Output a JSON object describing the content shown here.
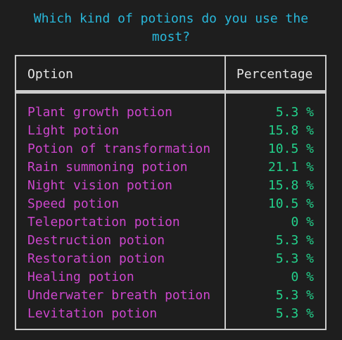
{
  "question": "Which kind of potions do you use the\nmost?",
  "table": {
    "headers": {
      "option": "Option",
      "percentage": "Percentage"
    },
    "rows": [
      {
        "option": "Plant growth potion",
        "percentage": "5.3 %"
      },
      {
        "option": "Light potion",
        "percentage": "15.8 %"
      },
      {
        "option": "Potion of transformation",
        "percentage": "10.5 %"
      },
      {
        "option": "Rain summoning potion",
        "percentage": "21.1 %"
      },
      {
        "option": "Night vision potion",
        "percentage": "15.8 %"
      },
      {
        "option": "Speed potion",
        "percentage": "10.5 %"
      },
      {
        "option": "Teleportation potion",
        "percentage": "0 %"
      },
      {
        "option": "Destruction potion",
        "percentage": "5.3 %"
      },
      {
        "option": "Restoration potion",
        "percentage": "5.3 %"
      },
      {
        "option": "Healing potion",
        "percentage": "0 %"
      },
      {
        "option": "Underwater breath potion",
        "percentage": "5.3 %"
      },
      {
        "option": "Levitation potion",
        "percentage": "5.3 %"
      }
    ]
  },
  "colors": {
    "background": "#1e1e1e",
    "question": "#29b8db",
    "option_text": "#cd46cd",
    "percentage_text": "#23d18b",
    "border": "#cccccc",
    "header_text": "#e5e5e5"
  }
}
